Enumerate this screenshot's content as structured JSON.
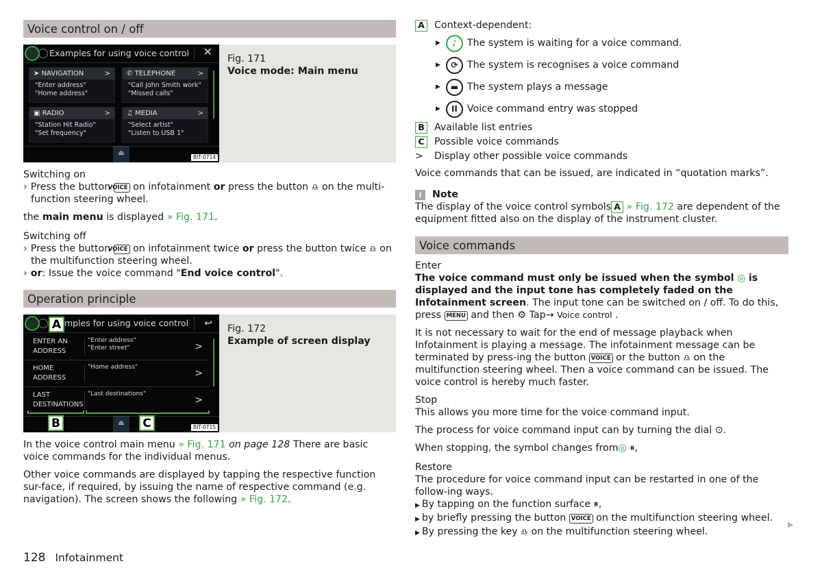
{
  "left": {
    "section1_title": "Voice control on / off",
    "fig171": {
      "number": "Fig. 171",
      "caption": "Voice mode: Main menu",
      "screen_title": "Examples for using voice control",
      "close_icon": "close-icon",
      "tiles": [
        {
          "label": "NAVIGATION",
          "icon": "navigation-arrow-icon",
          "glyph": "➤",
          "lines": [
            "\"Enter address\"",
            "\"Home address\""
          ]
        },
        {
          "label": "TELEPHONE",
          "icon": "phone-icon",
          "glyph": "✆",
          "lines": [
            "\"Call John Smith work\"",
            "\"Missed calls\""
          ]
        },
        {
          "label": "RADIO",
          "icon": "radio-icon",
          "glyph": "▣",
          "lines": [
            "\"Station Hit Radio\"",
            "\"Set frequency\""
          ]
        },
        {
          "label": "MEDIA",
          "icon": "music-note-icon",
          "glyph": "♫",
          "lines": [
            "\"Select artist\"",
            "\"Listen to USB 1\""
          ]
        }
      ],
      "chevron": ">",
      "code": "BIT-0714"
    },
    "switching_on": {
      "heading": "Switching on",
      "b1_a": "Press the button",
      "key_voice": "VOICE",
      "b1_b": "on infotainment",
      "or": "or",
      "b1_c": "press the button",
      "b1_d": "on the multi-function steering wheel.",
      "p_a": "the",
      "p_bold": "main menu",
      "p_b": "is displayed",
      "p_link": "» Fig. 171",
      "p_end": "."
    },
    "switching_off": {
      "heading": "Switching off",
      "b1_a": "Press the button",
      "b1_b": "on infotainment twice",
      "b1_c": "press the button twice",
      "b1_d": "on the multifunction steering wheel.",
      "b2_or": "or",
      "b2_a": ": Issue the voice command \"",
      "b2_bold": "End voice control",
      "b2_end": "\"."
    },
    "section2_title": "Operation principle",
    "fig172": {
      "number": "Fig. 172",
      "caption": "Example of screen display",
      "screen_title": "mples for using voice control",
      "back_icon": "back-arrow-icon",
      "rows": [
        {
          "label": [
            "ENTER AN",
            "ADDRESS"
          ],
          "cmds": [
            "\"Enter address\"",
            "\"Enter street\""
          ]
        },
        {
          "label": [
            "HOME",
            "ADDRESS"
          ],
          "cmds": [
            "\"Home address\""
          ]
        },
        {
          "label": [
            "LAST",
            "DESTINATIONS"
          ],
          "cmds": [
            "\"Last destinations\""
          ]
        }
      ],
      "callouts": [
        "A",
        "B",
        "C"
      ],
      "code": "BIT-0715"
    },
    "para1_a": "In the voice control main menu",
    "para1_link": "» Fig. 171",
    "para1_i": "on page 128",
    "para1_b": "There are basic voice commands for the individual menus.",
    "para2_a": "Other voice commands are displayed by tapping the respective function sur-face, if required, by issuing the name of respective command (e.g. navigation). The screen shows the following",
    "para2_link": "» Fig. 172",
    "para2_end": "."
  },
  "right": {
    "legend": {
      "A": "Context-dependent:",
      "A_items": [
        {
          "icon": "voice-waiting-icon",
          "glyph": "♪",
          "text": "The system is waiting for a voice command."
        },
        {
          "icon": "voice-recognising-icon",
          "glyph": "⟳",
          "text": "The system is recognises a voice command"
        },
        {
          "icon": "message-playing-icon",
          "glyph": "▬",
          "text": "The system plays a message"
        },
        {
          "icon": "pause-icon",
          "glyph": "II",
          "text": "Voice command entry was stopped"
        }
      ],
      "B": "Available list entries",
      "C": "Possible voice commands",
      "gt_symbol": ">",
      "gt_text": "Display other possible voice commands"
    },
    "quote_note": "Voice commands that can be issued, are indicated in “quotation marks”.",
    "note": {
      "title": "Note",
      "a": "The display of the voice control symbols",
      "box": "A",
      "link": "» Fig. 172",
      "b": "are dependent of the equipment fitted also on the display of the instrument cluster."
    },
    "section3_title": "Voice commands",
    "enter": {
      "heading": "Enter",
      "bold_a": "The voice command must only be issued when the symbol",
      "bold_b": "is displayed and the input tone has completely faded on the Infotainment screen",
      "rest_a": ". The input tone can be switched on / off. To do this, press",
      "key_menu": "MENU",
      "rest_b": "and then",
      "rest_c": "Tap→",
      "rest_d": "Voice control",
      "rest_e": "."
    },
    "para_playback": {
      "a": "It is not necessary to wait for the end of message playback when Infotainment is playing a message. The infotainment message can be terminated by press-ing the button",
      "key": "VOICE",
      "b": "or the button",
      "c": "on the multifunction steering wheel. Then a voice command can be issued. The voice control is hereby much faster."
    },
    "stop": {
      "heading": "Stop",
      "line1": "This allows you more time for the voice command input.",
      "line2_a": "The process for voice command input can by turning the dial",
      "line2_b": ".",
      "line3_a": "When stopping, the symbol changes from",
      "line3_b": ","
    },
    "restore": {
      "heading": "Restore",
      "intro": "The procedure for voice command input can be restarted in one of the follow-ing ways.",
      "b1_a": "By tapping on the function surface",
      "b1_b": ",",
      "b2_a": "by briefly pressing the button",
      "b2_key": "VOICE",
      "b2_b": "on the multifunction steering wheel.",
      "b3_a": "By pressing the key",
      "b3_b": "on the multifunction steering wheel."
    }
  },
  "footer": {
    "page_number": "128",
    "chapter": "Infotainment",
    "continue_icon": "continue-arrow-icon"
  },
  "colors": {
    "section_header_bg": "#c2bab9",
    "figure_bg": "#e6e5e1",
    "link_green": "#3aa04a",
    "callout_green": "#5ba948"
  }
}
